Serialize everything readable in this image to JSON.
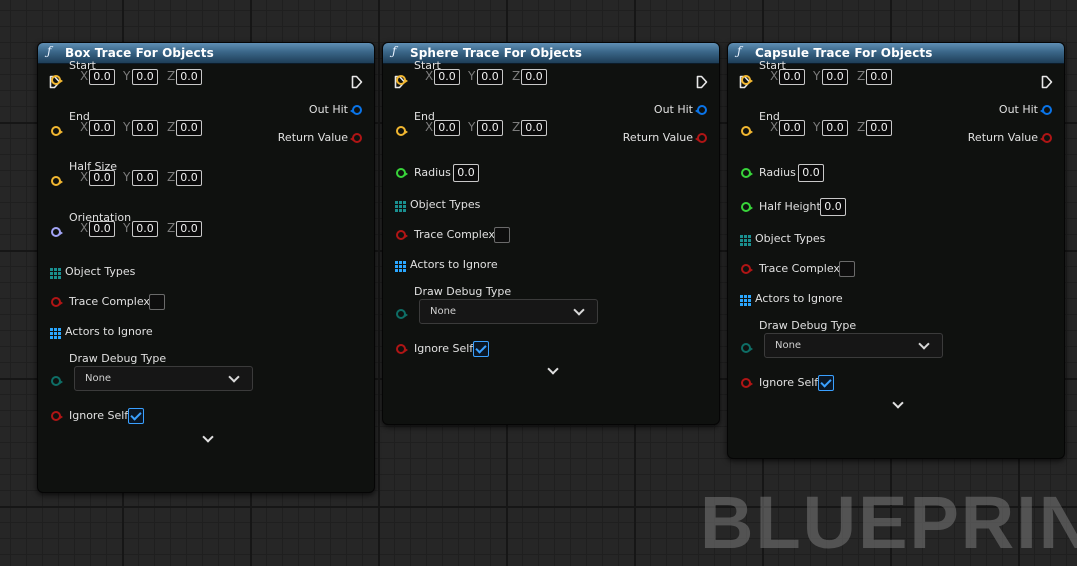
{
  "nodes": [
    {
      "title": "Box Trace For Objects",
      "fn_icon": "ƒ",
      "start_label": "Start",
      "end_label": "End",
      "half_size_label": "Half Size",
      "orientation_label": "Orientation",
      "axes": [
        "X",
        "Y",
        "Z"
      ],
      "start": [
        "0.0",
        "0.0",
        "0.0"
      ],
      "end": [
        "0.0",
        "0.0",
        "0.0"
      ],
      "half_size": [
        "0.0",
        "0.0",
        "0.0"
      ],
      "orientation": [
        "0.0",
        "0.0",
        "0.0"
      ],
      "object_types_label": "Object Types",
      "trace_complex_label": "Trace Complex",
      "trace_complex_checked": false,
      "actors_to_ignore_label": "Actors to Ignore",
      "draw_debug_type_label": "Draw Debug Type",
      "draw_debug_type_value": "None",
      "ignore_self_label": "Ignore Self",
      "ignore_self_checked": true,
      "out_hit_label": "Out Hit",
      "return_value_label": "Return Value"
    },
    {
      "title": "Sphere Trace For Objects",
      "fn_icon": "ƒ",
      "start_label": "Start",
      "end_label": "End",
      "axes": [
        "X",
        "Y",
        "Z"
      ],
      "start": [
        "0.0",
        "0.0",
        "0.0"
      ],
      "end": [
        "0.0",
        "0.0",
        "0.0"
      ],
      "radius_label": "Radius",
      "radius": "0.0",
      "object_types_label": "Object Types",
      "trace_complex_label": "Trace Complex",
      "trace_complex_checked": false,
      "actors_to_ignore_label": "Actors to Ignore",
      "draw_debug_type_label": "Draw Debug Type",
      "draw_debug_type_value": "None",
      "ignore_self_label": "Ignore Self",
      "ignore_self_checked": true,
      "out_hit_label": "Out Hit",
      "return_value_label": "Return Value"
    },
    {
      "title": "Capsule Trace For Objects",
      "fn_icon": "ƒ",
      "start_label": "Start",
      "end_label": "End",
      "axes": [
        "X",
        "Y",
        "Z"
      ],
      "start": [
        "0.0",
        "0.0",
        "0.0"
      ],
      "end": [
        "0.0",
        "0.0",
        "0.0"
      ],
      "radius_label": "Radius",
      "radius": "0.0",
      "half_height_label": "Half Height",
      "half_height": "0.0",
      "object_types_label": "Object Types",
      "trace_complex_label": "Trace Complex",
      "trace_complex_checked": false,
      "actors_to_ignore_label": "Actors to Ignore",
      "draw_debug_type_label": "Draw Debug Type",
      "draw_debug_type_value": "None",
      "ignore_self_label": "Ignore Self",
      "ignore_self_checked": true,
      "out_hit_label": "Out Hit",
      "return_value_label": "Return Value"
    }
  ],
  "watermark": "BLUEPRINT",
  "colors": {
    "header": "#3a6688",
    "vector_pin": "#f1b731",
    "rotator_pin": "#a2a4f5",
    "float_pin": "#38d43a",
    "bool_pin": "#b01515",
    "enum_pin": "#0e6e66",
    "hit_result_pin": "#0a74e8",
    "object_array_icon": "#1a8f8f",
    "actor_array_icon": "#2aa7ff"
  }
}
